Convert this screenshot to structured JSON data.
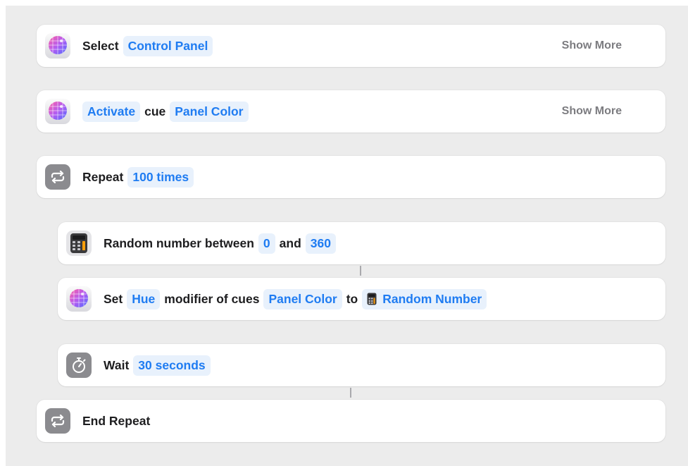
{
  "actions": [
    {
      "id": "select",
      "icon": "disco-ball-icon",
      "label": "Select",
      "tokens": [
        "Control Panel"
      ],
      "show_more": "Show More"
    },
    {
      "id": "activate",
      "icon": "disco-ball-icon",
      "token_first": "Activate",
      "label": "cue",
      "tokens": [
        "Panel Color"
      ],
      "show_more": "Show More"
    },
    {
      "id": "repeat",
      "icon": "repeat-icon",
      "label": "Repeat",
      "tokens": [
        "100 times"
      ]
    },
    {
      "id": "random",
      "icon": "calculator-icon",
      "label": "Random number between",
      "token_a": "0",
      "label_and": "and",
      "token_b": "360"
    },
    {
      "id": "set-hue",
      "icon": "disco-ball-icon",
      "label": "Set",
      "token_property": "Hue",
      "label_modifier": "modifier of cues",
      "token_cue": "Panel Color",
      "label_to": "to",
      "token_value": "Random Number",
      "token_value_icon": "calculator-icon"
    },
    {
      "id": "wait",
      "icon": "stopwatch-icon",
      "label": "Wait",
      "tokens": [
        "30 seconds"
      ]
    },
    {
      "id": "end-repeat",
      "icon": "repeat-icon",
      "label": "End Repeat"
    }
  ],
  "colors": {
    "canvas": "#ececec",
    "token_text": "#1f7cf2",
    "token_bg": "#e8f1fc",
    "label_text": "#1d1d1f",
    "muted": "#7c7c80",
    "icon_gray": "#8b8b8f"
  }
}
